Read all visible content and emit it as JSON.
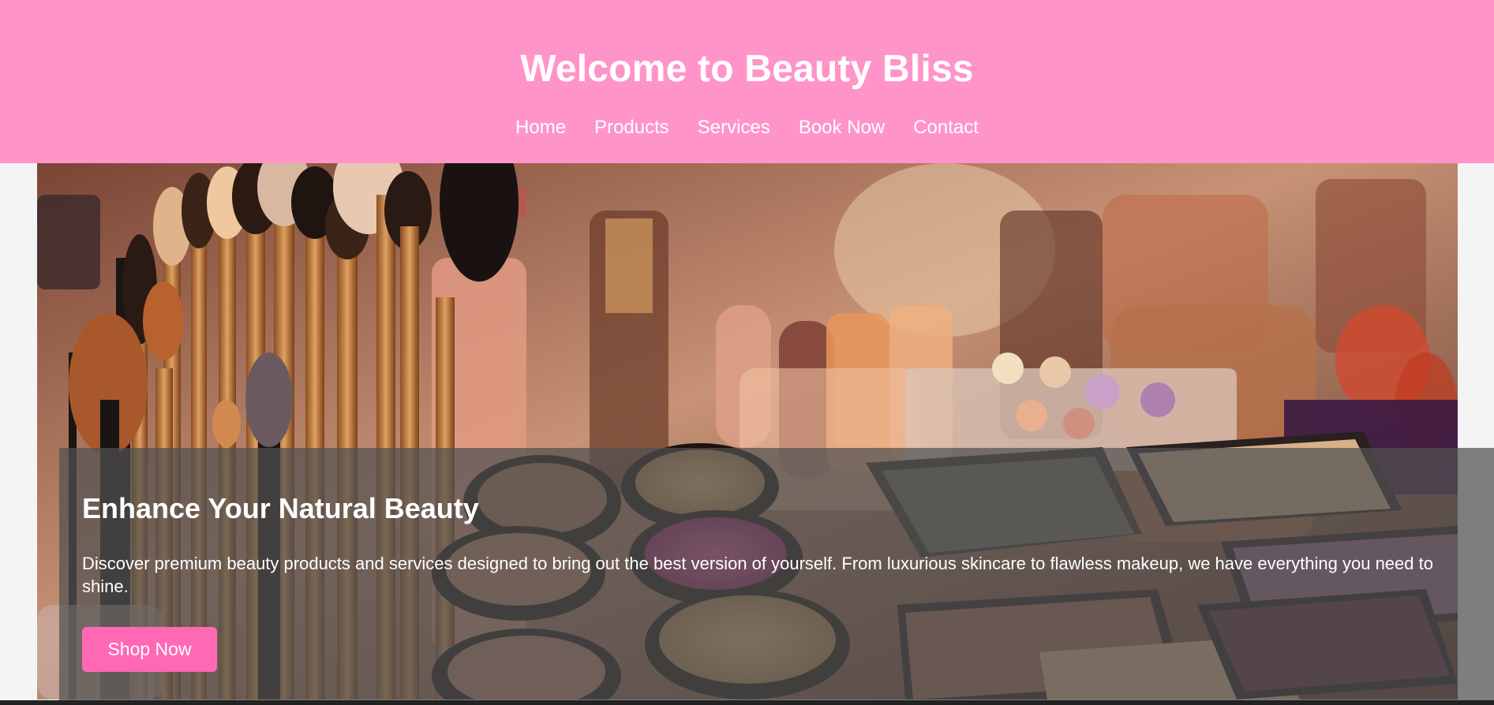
{
  "header": {
    "title": "Welcome to Beauty Bliss",
    "nav": [
      "Home",
      "Products",
      "Services",
      "Book Now",
      "Contact"
    ]
  },
  "hero": {
    "image_description": "makeup brushes and cosmetics",
    "heading": "Enhance Your Natural Beauty",
    "text": "Discover premium beauty products and services designed to bring out the best version of yourself. From luxurious skincare to flawless makeup, we have everything you need to shine.",
    "button_label": "Shop Now"
  },
  "colors": {
    "header_bg": "#ff94c8",
    "button_bg": "#ff69b4",
    "page_bg": "#f4f4f4"
  }
}
